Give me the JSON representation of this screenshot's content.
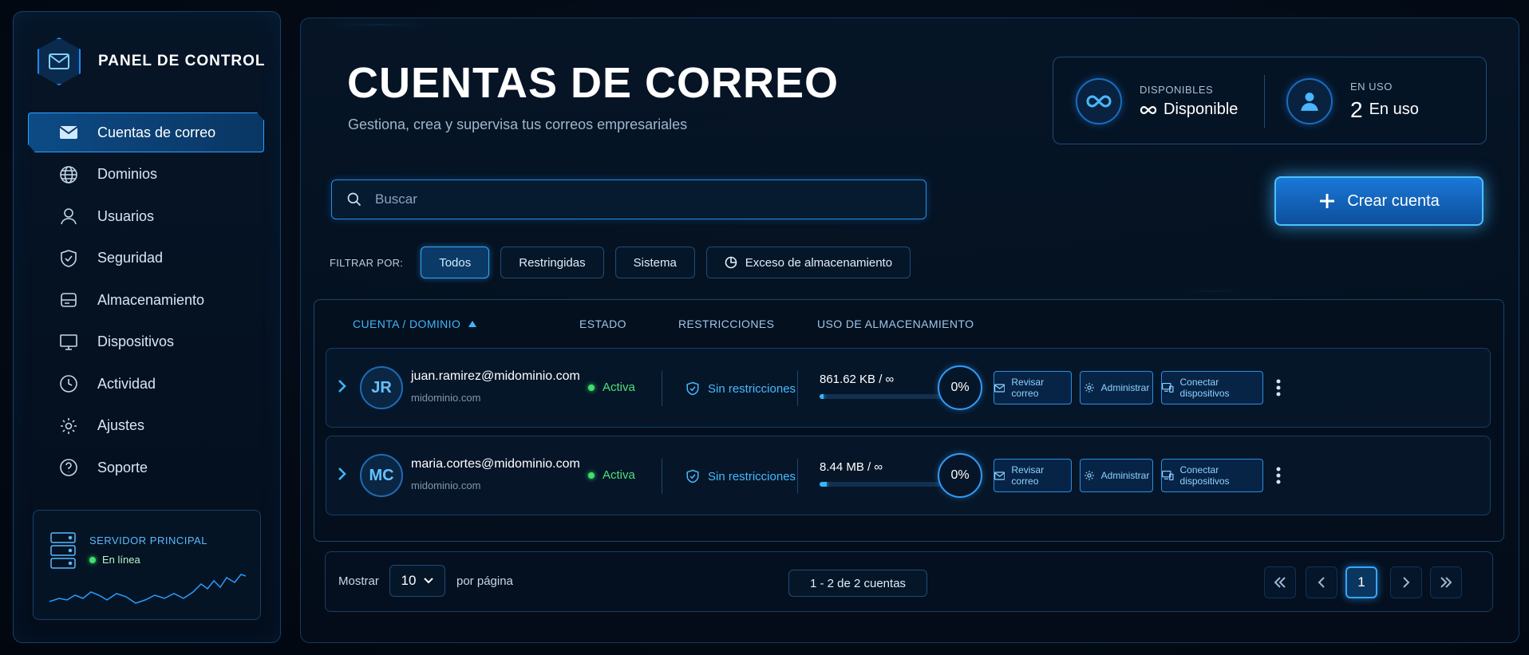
{
  "sidebar": {
    "brand": "PANEL DE CONTROL",
    "items": [
      {
        "label": "Cuentas de correo",
        "icon": "mail-icon",
        "active": true
      },
      {
        "label": "Dominios",
        "icon": "globe-icon"
      },
      {
        "label": "Usuarios",
        "icon": "user-icon"
      },
      {
        "label": "Seguridad",
        "icon": "shield-icon"
      },
      {
        "label": "Almacenamiento",
        "icon": "storage-icon"
      },
      {
        "label": "Dispositivos",
        "icon": "monitor-icon"
      },
      {
        "label": "Actividad",
        "icon": "clock-icon"
      },
      {
        "label": "Ajustes",
        "icon": "gear-icon"
      },
      {
        "label": "Soporte",
        "icon": "help-icon"
      }
    ],
    "server": {
      "title": "SERVIDOR PRINCIPAL",
      "status": "En línea"
    }
  },
  "header": {
    "title": "CUENTAS DE CORREO",
    "subtitle": "Gestiona, crea y supervisa tus correos empresariales"
  },
  "stats": {
    "available_label": "DISPONIBLES",
    "available_value": "Disponible",
    "in_use_label": "EN USO",
    "in_use_count": "2",
    "in_use_value": "En uso"
  },
  "search": {
    "placeholder": "Buscar"
  },
  "create_button": "Crear cuenta",
  "filters": {
    "label": "FILTRAR POR:",
    "options": [
      "Todos",
      "Restringidas",
      "Sistema",
      "Exceso de almacenamiento"
    ],
    "active": "Todos"
  },
  "table": {
    "columns": [
      "CUENTA / DOMINIO",
      "ESTADO",
      "RESTRICCIONES",
      "USO DE ALMACENAMIENTO"
    ],
    "rows": [
      {
        "initials": "JR",
        "email": "juan.ramirez@midominio.com",
        "domain": "midominio.com",
        "status": "Activa",
        "restrictions": "Sin restricciones",
        "usage": "861.62 KB / ∞",
        "usage_fraction": 0.03,
        "percent": "0%",
        "actions": [
          "Revisar correo",
          "Administrar",
          "Conectar dispositivos"
        ]
      },
      {
        "initials": "MC",
        "email": "maria.cortes@midominio.com",
        "domain": "midominio.com",
        "status": "Activa",
        "restrictions": "Sin restricciones",
        "usage": "8.44 MB / ∞",
        "usage_fraction": 0.06,
        "percent": "0%",
        "actions": [
          "Revisar correo",
          "Administrar",
          "Conectar dispositivos"
        ]
      }
    ]
  },
  "pagination": {
    "show_label": "Mostrar",
    "per_page": "10",
    "per_page_label": "por página",
    "range": "1 - 2 de 2 cuentas",
    "current_page": "1"
  },
  "colors": {
    "accent": "#1aa3ff",
    "success": "#3fe06b",
    "background": "#030b16"
  }
}
